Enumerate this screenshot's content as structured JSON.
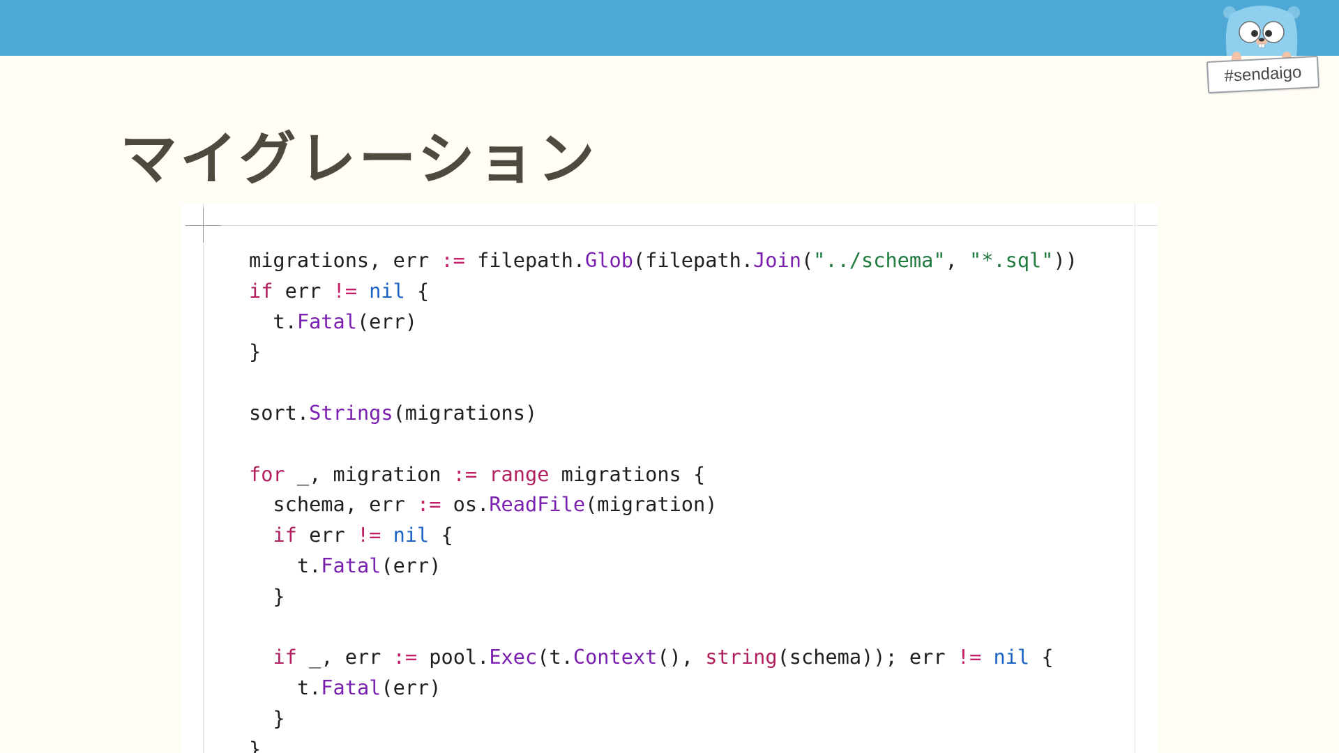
{
  "slide": {
    "title": "マイグレーション",
    "hashtag": "#sendaigo"
  },
  "colors": {
    "topbar": "#4fa9d6",
    "background": "#fffdf6",
    "title": "#4e4a3e",
    "keyword": "#b11f5f",
    "nil": "#1b63c6",
    "function": "#7b1fb0",
    "string": "#1f7a3e"
  },
  "icons": {
    "mascot": "gopher-mascot-icon"
  },
  "code": {
    "language": "go",
    "lines": [
      [
        [
          "plain",
          "migrations, err "
        ],
        [
          "op",
          ":="
        ],
        [
          "plain",
          " filepath."
        ],
        [
          "fn",
          "Glob"
        ],
        [
          "plain",
          "(filepath."
        ],
        [
          "fn",
          "Join"
        ],
        [
          "plain",
          "("
        ],
        [
          "str",
          "\"../schema\""
        ],
        [
          "plain",
          ", "
        ],
        [
          "str",
          "\"*.sql\""
        ],
        [
          "plain",
          "))"
        ]
      ],
      [
        [
          "kw",
          "if"
        ],
        [
          "plain",
          " err "
        ],
        [
          "op",
          "!="
        ],
        [
          "plain",
          " "
        ],
        [
          "nil",
          "nil"
        ],
        [
          "plain",
          " {"
        ]
      ],
      [
        [
          "plain",
          "  t."
        ],
        [
          "fn",
          "Fatal"
        ],
        [
          "plain",
          "(err)"
        ]
      ],
      [
        [
          "plain",
          "}"
        ]
      ],
      [],
      [
        [
          "plain",
          "sort."
        ],
        [
          "fn",
          "Strings"
        ],
        [
          "plain",
          "(migrations)"
        ]
      ],
      [],
      [
        [
          "kw",
          "for"
        ],
        [
          "plain",
          " _, migration "
        ],
        [
          "op",
          ":="
        ],
        [
          "plain",
          " "
        ],
        [
          "kw",
          "range"
        ],
        [
          "plain",
          " migrations {"
        ]
      ],
      [
        [
          "plain",
          "  schema, err "
        ],
        [
          "op",
          ":="
        ],
        [
          "plain",
          " os."
        ],
        [
          "fn",
          "ReadFile"
        ],
        [
          "plain",
          "(migration)"
        ]
      ],
      [
        [
          "plain",
          "  "
        ],
        [
          "kw",
          "if"
        ],
        [
          "plain",
          " err "
        ],
        [
          "op",
          "!="
        ],
        [
          "plain",
          " "
        ],
        [
          "nil",
          "nil"
        ],
        [
          "plain",
          " {"
        ]
      ],
      [
        [
          "plain",
          "    t."
        ],
        [
          "fn",
          "Fatal"
        ],
        [
          "plain",
          "(err)"
        ]
      ],
      [
        [
          "plain",
          "  }"
        ]
      ],
      [],
      [
        [
          "plain",
          "  "
        ],
        [
          "kw",
          "if"
        ],
        [
          "plain",
          " _, err "
        ],
        [
          "op",
          ":="
        ],
        [
          "plain",
          " pool."
        ],
        [
          "fn",
          "Exec"
        ],
        [
          "plain",
          "(t."
        ],
        [
          "fn",
          "Context"
        ],
        [
          "plain",
          "(), "
        ],
        [
          "kw",
          "string"
        ],
        [
          "plain",
          "(schema)); err "
        ],
        [
          "op",
          "!="
        ],
        [
          "plain",
          " "
        ],
        [
          "nil",
          "nil"
        ],
        [
          "plain",
          " {"
        ]
      ],
      [
        [
          "plain",
          "    t."
        ],
        [
          "fn",
          "Fatal"
        ],
        [
          "plain",
          "(err)"
        ]
      ],
      [
        [
          "plain",
          "  }"
        ]
      ],
      [
        [
          "plain",
          "}"
        ]
      ]
    ]
  }
}
